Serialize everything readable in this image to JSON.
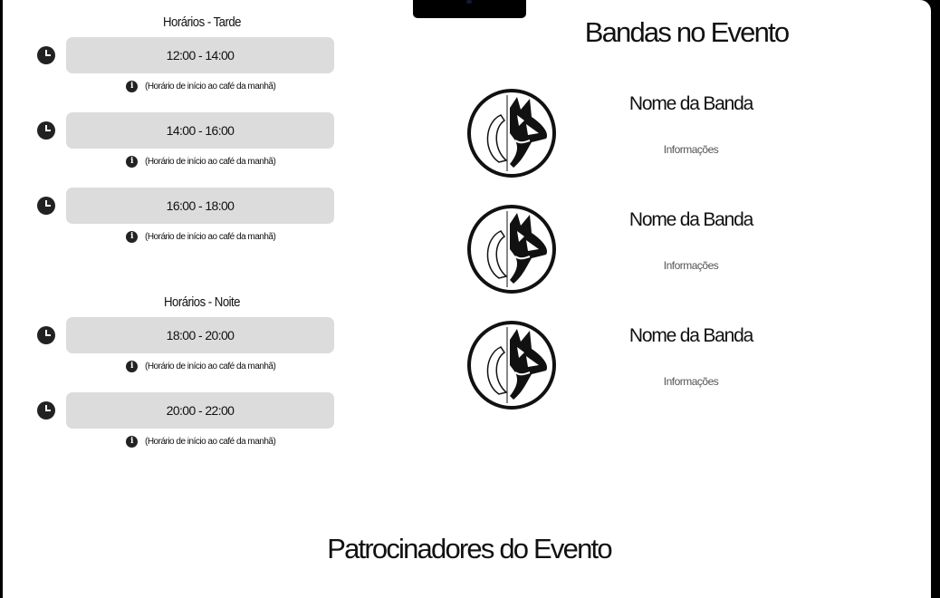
{
  "schedule": {
    "afternoon": {
      "title": "Horários - Tarde",
      "slots": [
        {
          "time": "12:00 - 14:00",
          "note": "(Horário de início ao café da manhã)"
        },
        {
          "time": "14:00 - 16:00",
          "note": "(Horário de início ao café da manhã)"
        },
        {
          "time": "16:00 - 18:00",
          "note": "(Horário de início ao café da manhã)"
        }
      ]
    },
    "night": {
      "title": "Horários - Noite",
      "slots": [
        {
          "time": "18:00 - 20:00",
          "note": "(Horário de início ao café da manhã)"
        },
        {
          "time": "20:00 - 22:00",
          "note": "(Horário de início ao café da manhã)"
        }
      ]
    }
  },
  "bands": {
    "title": "Bandas no Evento",
    "items": [
      {
        "name": "Nome da Banda",
        "info": "Informações"
      },
      {
        "name": "Nome da Banda",
        "info": "Informações"
      },
      {
        "name": "Nome da Banda",
        "info": "Informações"
      }
    ]
  },
  "sponsors": {
    "title": "Patrocinadores do Evento"
  },
  "icons": {
    "clock": "clock-icon",
    "info": "info-icon",
    "band_logo": "fox-guitar-logo"
  },
  "colors": {
    "background": "#000000",
    "page": "#ffffff",
    "slot_box": "#dcdcdc",
    "text": "#111111",
    "muted": "#555555"
  }
}
